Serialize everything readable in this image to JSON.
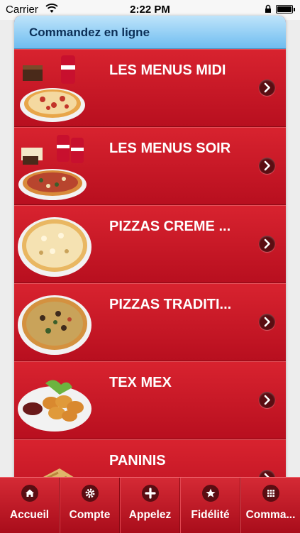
{
  "status_bar": {
    "carrier": "Carrier",
    "time": "2:22 PM"
  },
  "header": {
    "title": "Commandez en ligne"
  },
  "menu": {
    "items": [
      {
        "label": "LES MENUS MIDI",
        "image": "pizza-with-dessert-and-cola"
      },
      {
        "label": "LES MENUS SOIR",
        "image": "pizza-with-dessert-and-two-colas"
      },
      {
        "label": "PIZZAS CREME ...",
        "image": "cream-pizza"
      },
      {
        "label": "PIZZAS TRADITI...",
        "image": "traditional-pizza"
      },
      {
        "label": "TEX MEX",
        "image": "chicken-nuggets-with-sauce"
      },
      {
        "label": "PANINIS",
        "image": "panini"
      }
    ]
  },
  "tabbar": {
    "tabs": [
      {
        "label": "Accueil",
        "icon": "home-icon"
      },
      {
        "label": "Compte",
        "icon": "gear-icon"
      },
      {
        "label": "Appelez",
        "icon": "plus-icon"
      },
      {
        "label": "Fidélité",
        "icon": "star-icon"
      },
      {
        "label": "Comma...",
        "icon": "grid-icon"
      }
    ]
  },
  "colors": {
    "primary_red": "#c51626",
    "header_blue": "#6fbdf0",
    "header_text": "#0b2f57"
  }
}
